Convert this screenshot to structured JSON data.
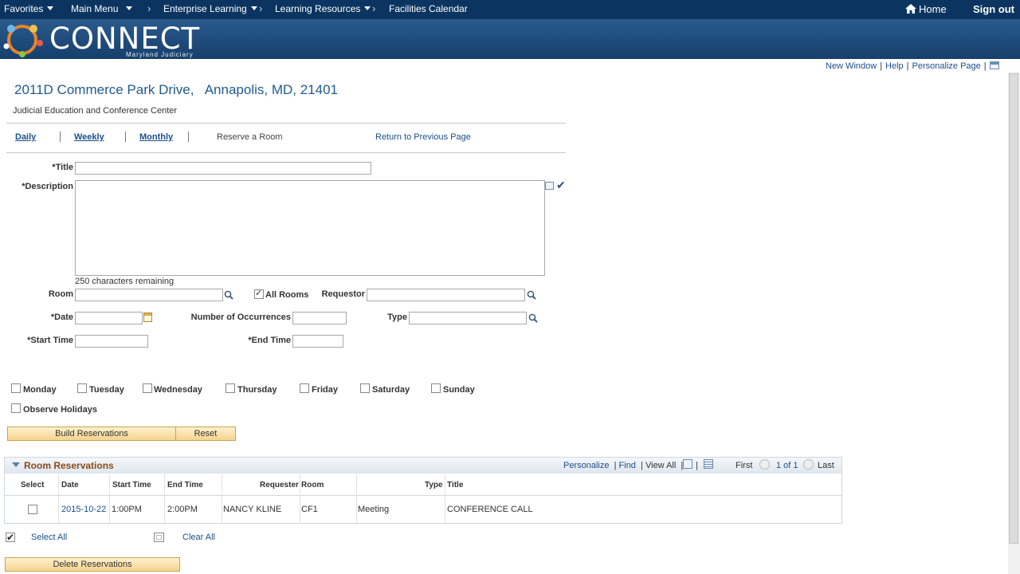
{
  "nav": {
    "favorites": "Favorites",
    "main_menu": "Main Menu",
    "enterprise_learning": "Enterprise Learning",
    "learning_resources": "Learning Resources",
    "facilities_calendar": "Facilities Calendar",
    "home": "Home",
    "sign_out": "Sign out"
  },
  "banner": {
    "logo_text": "CONNECT",
    "logo_subtitle": "Maryland Judiciary"
  },
  "utility": {
    "new_window": "New Window",
    "help": "Help",
    "personalize_page": "Personalize Page"
  },
  "page": {
    "address": "2011D Commerce Park Drive,   Annapolis, MD, 21401",
    "center_name": "Judicial Education and Conference Center"
  },
  "tabs": {
    "daily": "Daily",
    "weekly": "Weekly",
    "monthly": "Monthly",
    "reserve": "Reserve a Room",
    "return": "Return to Previous Page"
  },
  "form": {
    "title_label": "*Title",
    "title_value": "",
    "description_label": "*Description",
    "description_value": "",
    "chars_remaining": "250 characters remaining",
    "room_label": "Room",
    "room_value": "",
    "all_rooms_label": "All Rooms",
    "all_rooms_checked": true,
    "requestor_label": "Requestor",
    "requestor_value": "",
    "date_label": "*Date",
    "date_value": "",
    "occurrences_label": "Number of Occurrences",
    "occurrences_value": "",
    "type_label": "Type",
    "type_value": "",
    "start_time_label": "*Start Time",
    "start_time_value": "",
    "end_time_label": "*End Time",
    "end_time_value": ""
  },
  "days": {
    "monday": "Monday",
    "tuesday": "Tuesday",
    "wednesday": "Wednesday",
    "thursday": "Thursday",
    "friday": "Friday",
    "saturday": "Saturday",
    "sunday": "Sunday",
    "observe_holidays": "Observe Holidays"
  },
  "buttons": {
    "build": "Build Reservations",
    "reset": "Reset",
    "delete": "Delete Reservations"
  },
  "grid": {
    "title": "Room Reservations",
    "personalize": "Personalize",
    "find": "Find",
    "view_all": "View All",
    "first": "First",
    "page_count": "1 of 1",
    "last": "Last",
    "columns": {
      "select": "Select",
      "date": "Date",
      "start": "Start Time",
      "end": "End Time",
      "requester": "Requester",
      "room": "Room",
      "type": "Type",
      "title": "Title"
    },
    "rows": [
      {
        "date": "2015-10-22",
        "start": "1:00PM",
        "end": "2:00PM",
        "requester": "NANCY KLINE",
        "room": "CF1",
        "type": "Meeting",
        "title": "CONFERENCE CALL"
      }
    ]
  },
  "select_all": "Select All",
  "clear_all": "Clear All",
  "colors": {
    "nav_bg": "#0b3560",
    "link": "#1a4f8a",
    "button_bg": "#f5d48e",
    "grid_title": "#8a4a17"
  }
}
